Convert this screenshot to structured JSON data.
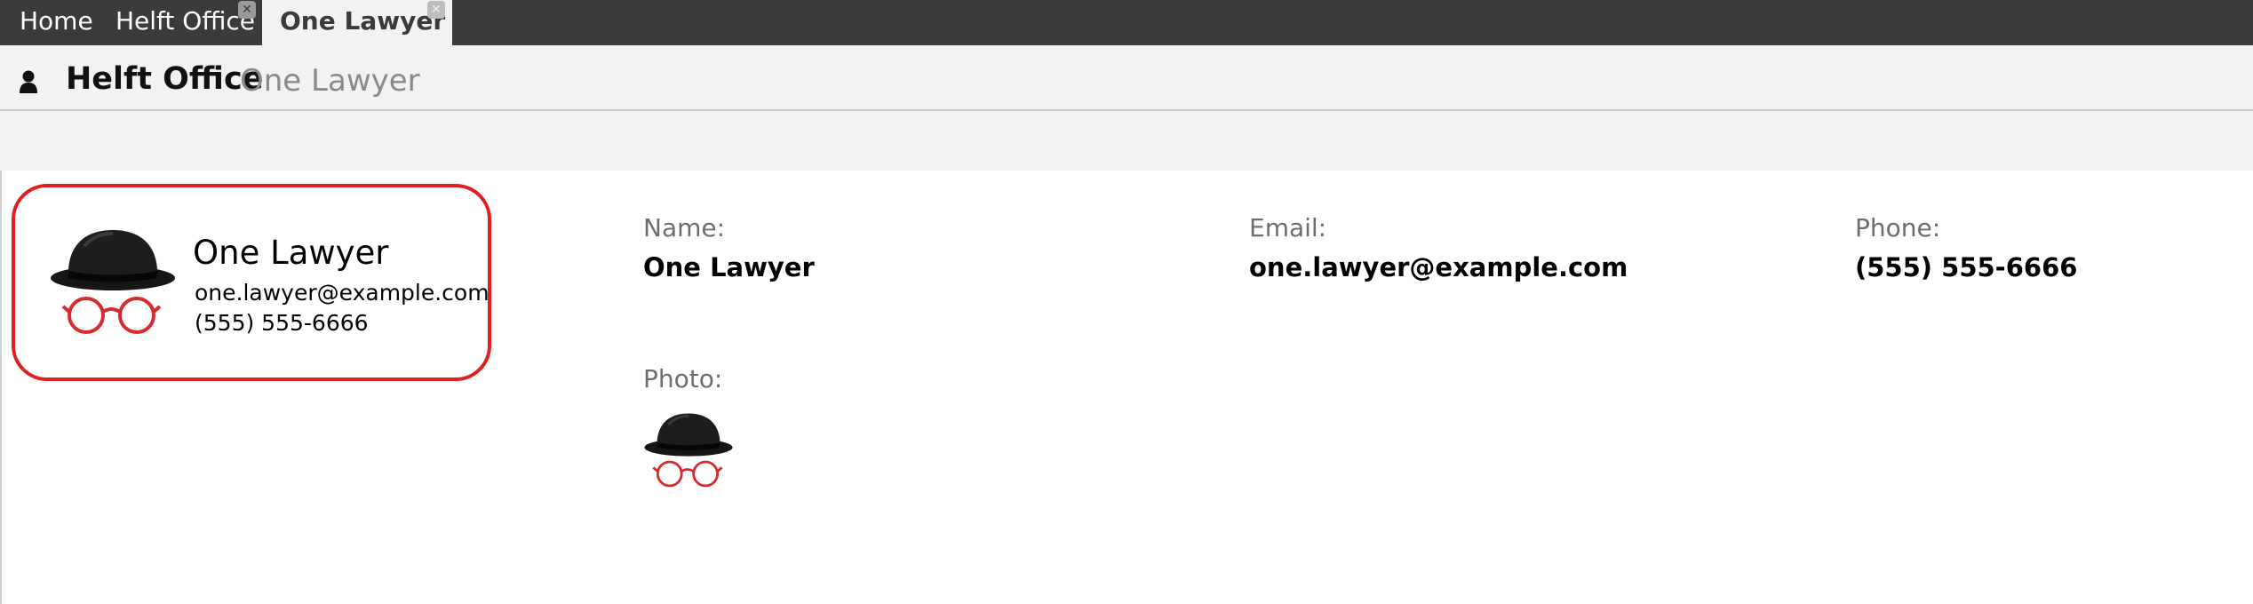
{
  "tabs": [
    {
      "label": "Home"
    },
    {
      "label": "Helft Office"
    },
    {
      "label": "One Lawyer"
    }
  ],
  "header": {
    "title": "Helft Office",
    "subtitle": "One Lawyer"
  },
  "card": {
    "name": "One Lawyer",
    "email": "one.lawyer@example.com",
    "phone": "(555) 555-6666"
  },
  "fields": {
    "name_label": "Name:",
    "name_value": "One Lawyer",
    "email_label": "Email:",
    "email_value": "one.lawyer@example.com",
    "phone_label": "Phone:",
    "phone_value": "(555) 555-6666",
    "photo_label": "Photo:"
  },
  "icons": {
    "user": "user-icon",
    "close": "close-icon",
    "avatar": "bowler-hat-glasses-avatar"
  },
  "colors": {
    "tabbar": "#3b3b3b",
    "header_bg": "#f2f2f2",
    "card_border": "#e02020",
    "glasses": "#d92b2b"
  }
}
